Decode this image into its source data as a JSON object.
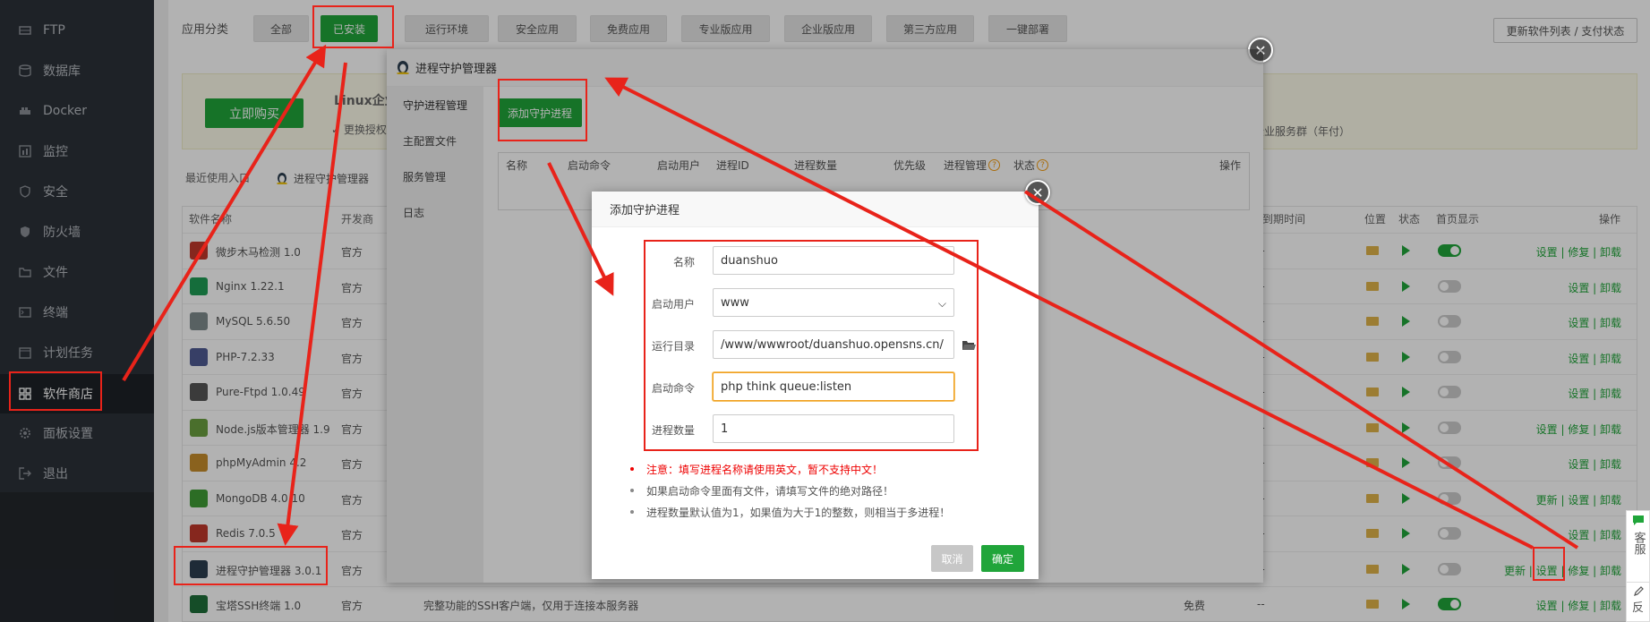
{
  "sidebar": {
    "items": [
      {
        "label": "FTP",
        "icon": "ftp-icon"
      },
      {
        "label": "数据库",
        "icon": "database-icon"
      },
      {
        "label": "Docker",
        "icon": "docker-icon"
      },
      {
        "label": "监控",
        "icon": "monitor-icon"
      },
      {
        "label": "安全",
        "icon": "shield-icon"
      },
      {
        "label": "防火墙",
        "icon": "firewall-icon"
      },
      {
        "label": "文件",
        "icon": "folder-icon"
      },
      {
        "label": "终端",
        "icon": "terminal-icon"
      },
      {
        "label": "计划任务",
        "icon": "schedule-icon"
      },
      {
        "label": "软件商店",
        "icon": "store-icon"
      },
      {
        "label": "面板设置",
        "icon": "gear-icon"
      },
      {
        "label": "退出",
        "icon": "logout-icon"
      }
    ]
  },
  "store": {
    "category_label": "应用分类",
    "tabs": [
      "全部",
      "已安装",
      "运行环境",
      "安全应用",
      "免费应用",
      "专业版应用",
      "企业版应用",
      "第三方应用",
      "一键部署"
    ],
    "active_tab": "已安装",
    "update_button": "更新软件列表 / 支付状态",
    "promo": {
      "buy_button": "立即购买",
      "title": "Linux企业",
      "subtitle": "✓ 更换授权",
      "right_text": "企业服务群（年付）"
    },
    "recent_label": "最近使用入口",
    "recent_item": "进程守护管理器",
    "columns": {
      "name": "软件名称",
      "developer": "开发商",
      "expire": "到期时间",
      "location": "位置",
      "status": "状态",
      "homepage": "首页显示",
      "actions": "操作"
    },
    "rows": [
      {
        "name": "微步木马检测 1.0",
        "dev": "官方",
        "home": true,
        "ops": "设置 | 修复 | 卸载",
        "icon": "trojan-scan-icon",
        "color": "#c0392b"
      },
      {
        "name": "Nginx 1.22.1",
        "dev": "官方",
        "home": false,
        "ops": "设置 | 卸载",
        "icon": "nginx-icon",
        "color": "#1f9d55"
      },
      {
        "name": "MySQL 5.6.50",
        "dev": "官方",
        "home": false,
        "ops": "设置 | 卸载",
        "icon": "mysql-icon",
        "color": "#7f8c8d"
      },
      {
        "name": "PHP-7.2.33",
        "dev": "官方",
        "home": false,
        "ops": "设置 | 卸载",
        "icon": "php-icon",
        "color": "#4f5b93"
      },
      {
        "name": "Pure-Ftpd 1.0.49",
        "dev": "官方",
        "home": false,
        "ops": "设置 | 卸载",
        "icon": "ftpd-icon",
        "color": "#555555"
      },
      {
        "name": "Node.js版本管理器 1.9",
        "dev": "官方",
        "home": false,
        "ops": "设置 | 修复 | 卸载",
        "icon": "nodejs-icon",
        "color": "#6a9f3f"
      },
      {
        "name": "phpMyAdmin 4.2",
        "dev": "官方",
        "home": false,
        "ops": "设置 | 卸载",
        "icon": "phpmyadmin-icon",
        "color": "#c68d2b"
      },
      {
        "name": "MongoDB 4.0.10",
        "dev": "官方",
        "home": false,
        "ops": "更新 | 设置 | 卸载",
        "icon": "mongodb-icon",
        "color": "#3f9c35"
      },
      {
        "name": "Redis 7.0.5",
        "dev": "官方",
        "home": false,
        "ops": "设置 | 卸载",
        "icon": "redis-icon",
        "color": "#c0392b"
      },
      {
        "name": "进程守护管理器 3.0.1",
        "dev": "官方",
        "home": false,
        "ops": "更新 | 设置 | 修复 | 卸载",
        "icon": "supervisor-icon",
        "color": "#2c3e50"
      },
      {
        "name": "宝塔SSH终端 1.0",
        "dev": "官方",
        "home": true,
        "ops": "设置 | 修复 | 卸载",
        "icon": "ssh-terminal-icon",
        "color": "#1f6f3a",
        "desc": "完整功能的SSH客户端，仅用于连接本服务器",
        "price": "免费",
        "expire": "--"
      }
    ],
    "expire_placeholder": "--"
  },
  "process_manager": {
    "title": "进程守护管理器",
    "menu": [
      "守护进程管理",
      "主配置文件",
      "服务管理",
      "日志"
    ],
    "add_button": "添加守护进程",
    "columns": [
      "名称",
      "启动命令",
      "启动用户",
      "进程ID",
      "进程数量",
      "优先级",
      "进程管理",
      "状态",
      "操作"
    ]
  },
  "add_dialog": {
    "title": "添加守护进程",
    "fields": {
      "name_label": "名称",
      "name_value": "duanshuo",
      "user_label": "启动用户",
      "user_value": "www",
      "dir_label": "运行目录",
      "dir_value": "/www/wwwroot/duanshuo.opensns.cn/",
      "cmd_label": "启动命令",
      "cmd_value": "php think queue:listen",
      "count_label": "进程数量",
      "count_value": "1"
    },
    "notes": [
      "注意：填写进程名称请使用英文，暂不支持中文！",
      "如果启动命令里面有文件，请填写文件的绝对路径！",
      "进程数量默认值为1，如果值为大于1的整数，则相当于多进程！"
    ],
    "cancel": "取消",
    "confirm": "确定"
  },
  "float_panel": {
    "service": "客服",
    "feedback": "反"
  },
  "colors": {
    "accent": "#20a53a",
    "annotation": "#e8231a",
    "sidebar_bg": "#2c3138"
  }
}
